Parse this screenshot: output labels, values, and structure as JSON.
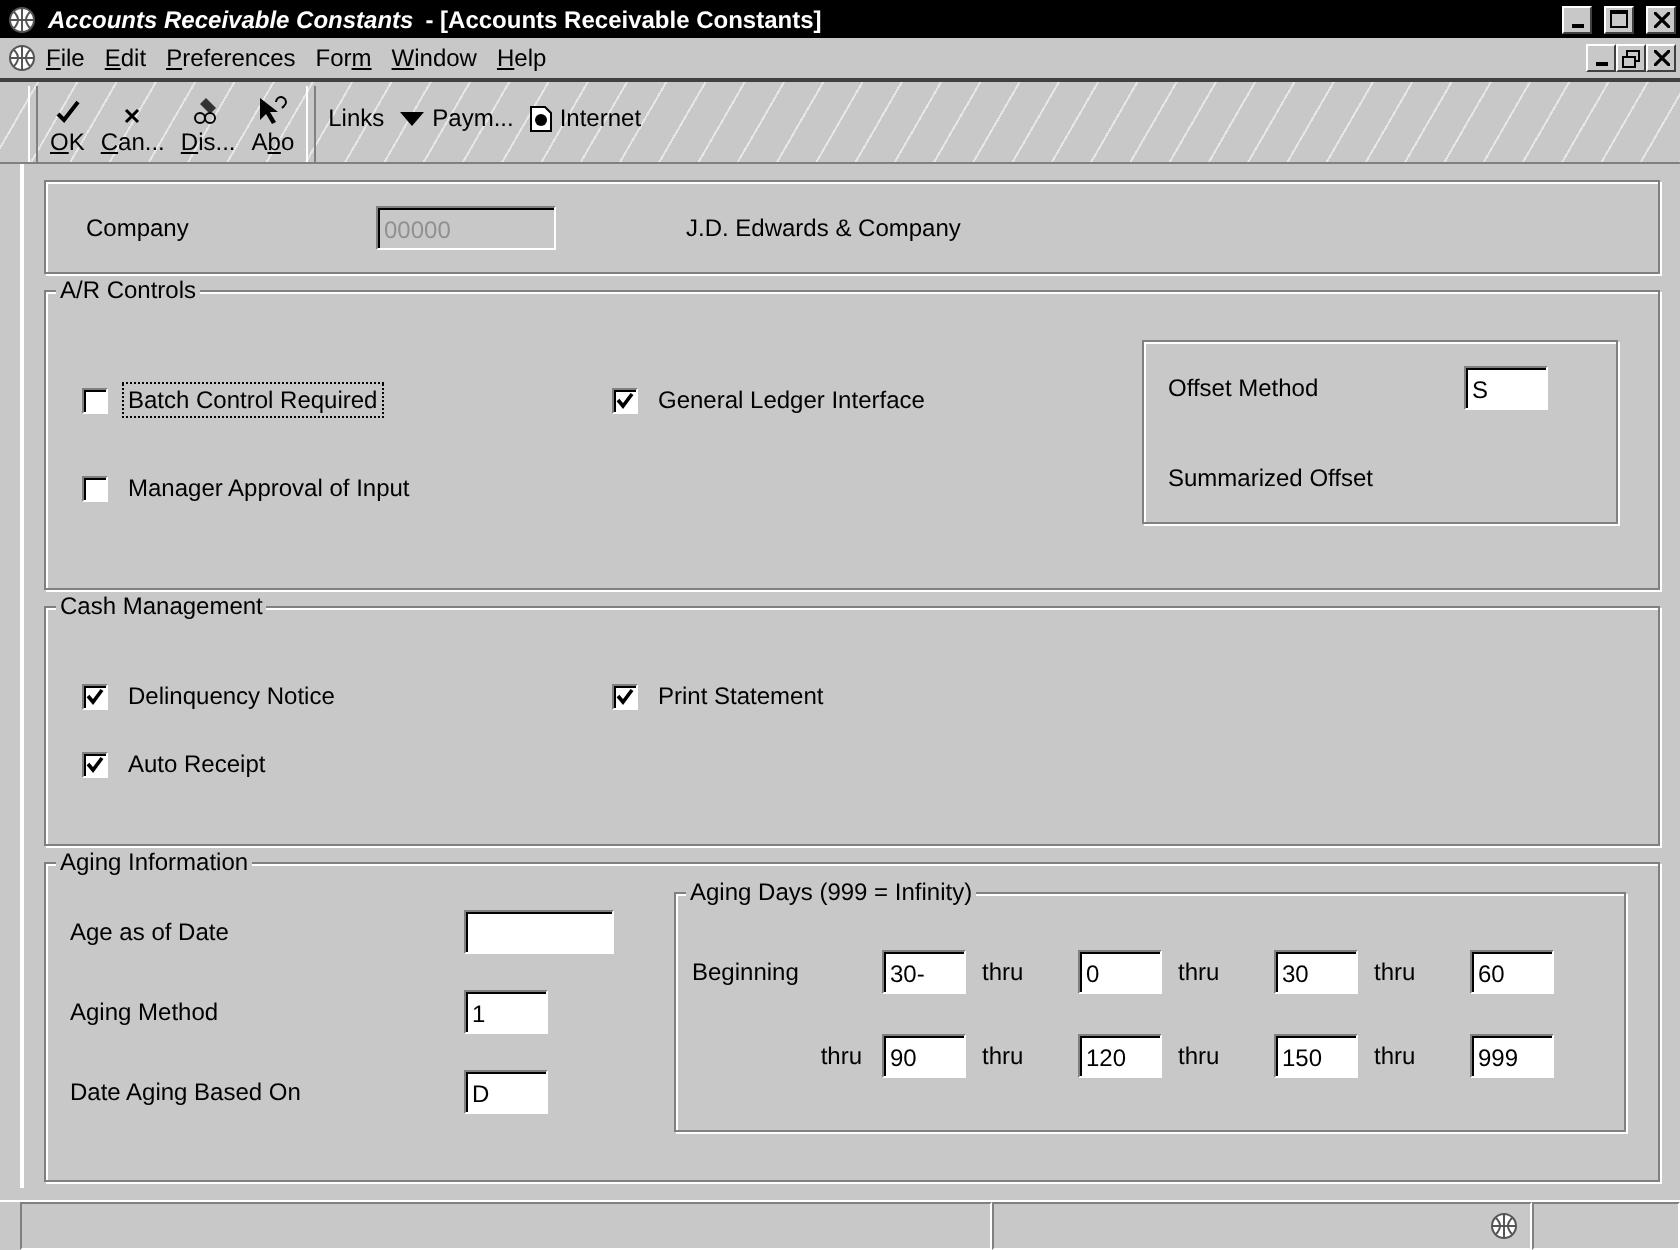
{
  "window": {
    "title": "Accounts Receivable Constants",
    "subtitle": " - [Accounts Receivable Constants]"
  },
  "menu": [
    {
      "accel": "F",
      "rest": "ile"
    },
    {
      "accel": "E",
      "rest": "dit"
    },
    {
      "accel": "P",
      "rest": "references"
    },
    {
      "lead": "For",
      "accel": "m"
    },
    {
      "accel": "W",
      "rest": "indow"
    },
    {
      "accel": "H",
      "rest": "elp"
    }
  ],
  "toolbar": {
    "buttons": [
      {
        "kind": "ok",
        "accel": "O",
        "rest": "K"
      },
      {
        "kind": "cancel",
        "accel": "C",
        "rest": "an..."
      },
      {
        "kind": "display",
        "accel": "D",
        "rest": "is..."
      },
      {
        "kind": "about",
        "lead": "A",
        "accel": "b",
        "rest": "o"
      }
    ],
    "links": [
      {
        "kind": "text",
        "label": "Links"
      },
      {
        "kind": "menu",
        "label": "Paym..."
      },
      {
        "kind": "doc",
        "label": "Internet"
      }
    ]
  },
  "company": {
    "label": "Company",
    "value": "00000",
    "disabled": true,
    "name": "J.D. Edwards & Company"
  },
  "ar_controls": {
    "title": "A/R Controls",
    "checkboxes": [
      {
        "label": "Batch Control Required",
        "checked": false,
        "focused": true
      },
      {
        "label": "General Ledger Interface",
        "checked": true,
        "focused": false
      },
      {
        "label": "Manager Approval of Input",
        "checked": false,
        "focused": false
      }
    ],
    "offset": {
      "label": "Offset Method",
      "value": "S",
      "description": "Summarized Offset"
    }
  },
  "cash_management": {
    "title": "Cash Management",
    "checkboxes": [
      {
        "label": "Delinquency Notice",
        "checked": true,
        "focused": false
      },
      {
        "label": "Print Statement",
        "checked": true,
        "focused": false
      },
      {
        "label": "Auto Receipt",
        "checked": true,
        "focused": false
      }
    ]
  },
  "aging": {
    "title": "Aging Information",
    "fields": [
      {
        "label": "Age as of Date",
        "kind": "wide"
      },
      {
        "label": "Aging Method",
        "value": "1",
        "kind": "narrow"
      },
      {
        "label": "Date Aging Based On",
        "value": "D",
        "kind": "narrow"
      }
    ],
    "days": {
      "title": "Aging Days (999 = Infinity)",
      "rows": [
        {
          "label": "Beginning",
          "cells": [
            {
              "value": "30-"
            },
            {
              "sep": "thru",
              "value": "0"
            },
            {
              "sep": "thru",
              "value": "30"
            },
            {
              "sep": "thru",
              "value": "60"
            }
          ]
        },
        {
          "label": "thru",
          "cells": [
            {
              "value": "90"
            },
            {
              "sep": "thru",
              "value": "120"
            },
            {
              "sep": "thru",
              "value": "150"
            },
            {
              "sep": "thru",
              "value": "999"
            }
          ]
        }
      ]
    }
  }
}
